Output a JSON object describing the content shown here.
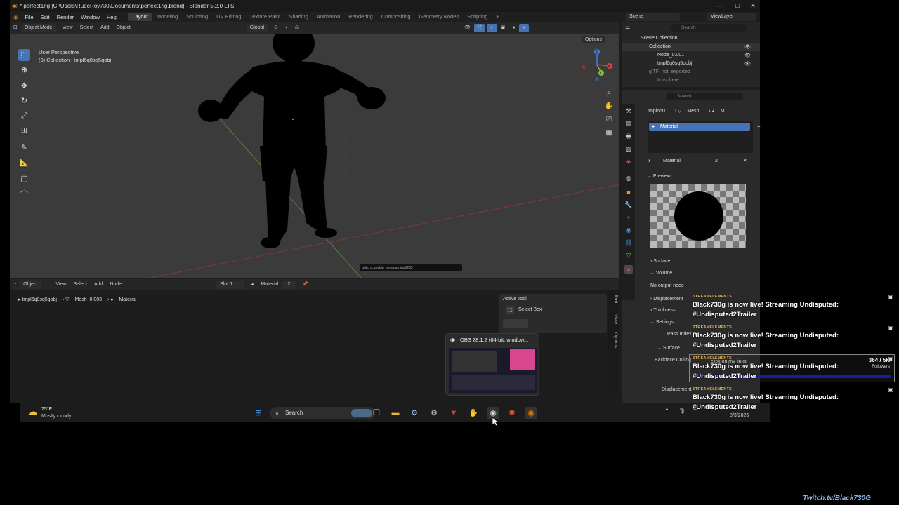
{
  "window": {
    "title": "* perfect1rig [C:\\Users\\RudeRoy730\\Documents\\perfect1rig.blend] - Blender 5.2.0 LTS",
    "minimize": "—",
    "maximize": "□",
    "close": "✕"
  },
  "menu": [
    "File",
    "Edit",
    "Render",
    "Window",
    "Help"
  ],
  "workspaces": [
    "Layout",
    "Modeling",
    "Sculpting",
    "UV Editing",
    "Texture Paint",
    "Shading",
    "Animation",
    "Rendering",
    "Compositing",
    "Geometry Nodes",
    "Scripting"
  ],
  "workspace_add": "+",
  "scene": {
    "label": "Scene",
    "view_layer": "ViewLayer"
  },
  "viewport": {
    "mode": "Object Mode",
    "menus": [
      "View",
      "Select",
      "Add",
      "Object"
    ],
    "orientation": "Global",
    "options": "Options",
    "caption1": "User Perspective",
    "caption2": "(0) Collection | tmpl6q0sq5qobj",
    "url_overlay": "twitch.com/big_nkxegaming0295",
    "axis_x": "X",
    "axis_y": "Y",
    "axis_z": "Z"
  },
  "bottom_editor": {
    "mode": "Object",
    "menus": [
      "View",
      "Select",
      "Add",
      "Node"
    ],
    "slot": "Slot 1",
    "material": "Material",
    "material_users": "2",
    "crumbs": [
      "tmpl6q0sq5qobj",
      "Mesh_0.003",
      "Material"
    ],
    "active_tool_title": "Active Tool",
    "active_tool": "Select Box",
    "side_tabs": [
      "Tool",
      "View",
      "Options"
    ]
  },
  "outliner": {
    "search_placeholder": "Search",
    "scene_collection": "Scene Collection",
    "rows": [
      "Collection",
      "Node_0.001",
      "tmpl6q0sq5qobj",
      "glTF_not_exported",
      "Icosphere"
    ]
  },
  "properties": {
    "search_placeholder": "Search",
    "crumb_obj": "tmpl6q0...",
    "crumb_mesh": "Mesh...",
    "crumb_mat": "M...",
    "slot_item": "Material",
    "material_name": "Material",
    "material_users": "2",
    "sections": {
      "preview": "Preview",
      "surface": "Surface",
      "volume": "Volume",
      "no_output": "No output node",
      "displacement": "Displacement",
      "thickness": "Thickness",
      "settings": "Settings",
      "pass_index": "Pass Index",
      "surface_sub": "Surface",
      "backface": "Backface Culling",
      "displacement2": "Displacement"
    }
  },
  "obs_preview": {
    "title": "OBS 28.1.2 (64-bit, window..."
  },
  "taskbar": {
    "weather_temp": "75°F",
    "weather_desc": "Mostly cloudy",
    "search": "Search",
    "date": "8/3/2026",
    "icons": [
      "start-icon",
      "search-icon",
      "task-view-icon",
      "file-explorer-icon",
      "steam-icon",
      "settings-icon",
      "brave-icon",
      "hand-app-icon",
      "obs-icon",
      "spark-icon",
      "blender-icon"
    ]
  },
  "notifications": {
    "source": "STREAMELEMENTS",
    "message": "Black730g is now live! Streaming Undisputed: #Undisputed2Trailer",
    "followers_count": "364 / 5K",
    "followers_label": "Followers",
    "hidden_text": "click on my links"
  },
  "watermark": "Twitch.tv/Black730G"
}
